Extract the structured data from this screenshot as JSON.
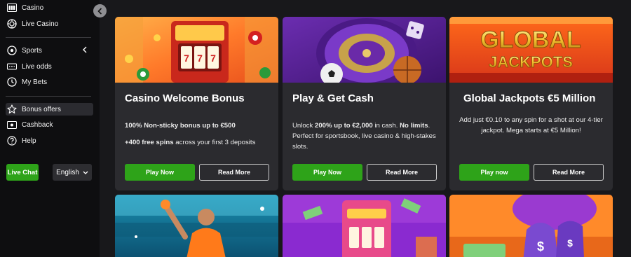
{
  "sidebar": {
    "items": [
      {
        "label": "Casino",
        "icon": "slot-machine-icon"
      },
      {
        "label": "Live Casino",
        "icon": "chip-icon"
      },
      {
        "label": "Sports",
        "icon": "soccer-ball-icon"
      },
      {
        "label": "Live odds",
        "icon": "scoreboard-icon"
      },
      {
        "label": "My Bets",
        "icon": "clock-icon"
      },
      {
        "label": "Bonus offers",
        "icon": "star-icon"
      },
      {
        "label": "Cashback",
        "icon": "cash-icon"
      },
      {
        "label": "Help",
        "icon": "help-circle-icon"
      }
    ],
    "live_chat_label": "Live Chat",
    "language": "English"
  },
  "cards": [
    {
      "title": "Casino Welcome Bonus",
      "line1_bold": "100% Non-sticky bonus up to €500",
      "line2_bold": "+400 free spins",
      "line2_rest": " across your first 3 deposits",
      "play_label": "Play Now",
      "read_label": "Read More"
    },
    {
      "title": "Play & Get Cash",
      "t1": "Unlock ",
      "t1_bold": "200% up to €2,000",
      "t2": " in cash. ",
      "t2_bold": "No limits",
      "t3": ". Perfect for sportsbook, live casino & high-stakes slots.",
      "play_label": "Play Now",
      "read_label": "Read More"
    },
    {
      "title": "Global Jackpots €5 Million",
      "body": "Add just €0.10 to any spin for a shot at our 4-tier jackpot. Mega starts at €5 Million!",
      "banner_line1": "GLOBAL",
      "banner_line2": "JACKPOTS",
      "play_label": "Play now",
      "read_label": "Read More"
    }
  ],
  "colors": {
    "accent_green": "#2ea319",
    "card_bg": "#2b2b2f",
    "page_bg": "#18181b",
    "sidebar_bg": "#0e0e10"
  }
}
